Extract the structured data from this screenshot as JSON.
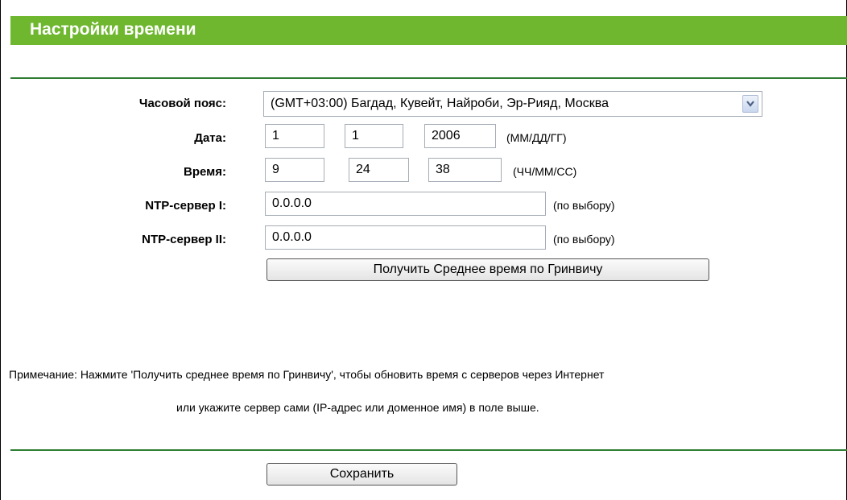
{
  "header": {
    "title": "Настройки времени"
  },
  "form": {
    "timezone": {
      "label": "Часовой пояс:",
      "value": "(GMT+03:00) Багдад, Кувейт, Найроби, Эр-Рияд, Москва"
    },
    "date": {
      "label": "Дата:",
      "month": "1",
      "day": "1",
      "year": "2006",
      "hint": "(ММ/ДД/ГГ)"
    },
    "time": {
      "label": "Время:",
      "hours": "9",
      "minutes": "24",
      "seconds": "38",
      "hint": "(ЧЧ/ММ/СС)"
    },
    "ntp1": {
      "label": "NTP-сервер I:",
      "value": "0.0.0.0",
      "hint": "(по выбору)"
    },
    "ntp2": {
      "label": "NTP-сервер II:",
      "value": "0.0.0.0",
      "hint": "(по выбору)"
    },
    "get_gmt_button": "Получить Среднее время по Гринвичу"
  },
  "note": {
    "line1": "Примечание: Нажмите 'Получить среднее время по Гринвичу', чтобы обновить время с серверов через Интернет",
    "line2": "или укажите сервер сами (IP-адрес или доменное имя) в поле выше."
  },
  "footer": {
    "save_button": "Сохранить"
  },
  "colors": {
    "title_bar": "#6fb72f",
    "divider": "#2e7d32"
  },
  "icons": {
    "dropdown": "chevron-down-icon"
  }
}
